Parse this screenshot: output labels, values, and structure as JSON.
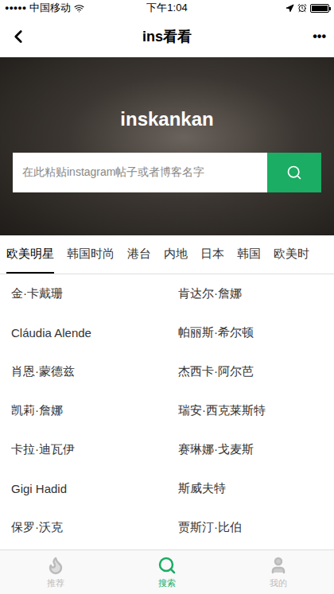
{
  "status_bar": {
    "signal": "●●●●●",
    "carrier": "中国移动",
    "time": "下午1:04"
  },
  "nav": {
    "title": "ins看看",
    "more": "•••"
  },
  "hero": {
    "title": "inskankan",
    "search_placeholder": "在此粘贴instagram帖子或者博客名字"
  },
  "tabs": [
    {
      "label": "欧美明星",
      "selected": true
    },
    {
      "label": "韩国时尚",
      "selected": false
    },
    {
      "label": "港台",
      "selected": false
    },
    {
      "label": "内地",
      "selected": false
    },
    {
      "label": "日本",
      "selected": false
    },
    {
      "label": "韩国",
      "selected": false
    },
    {
      "label": "欧美时",
      "selected": false
    }
  ],
  "names": [
    "金·卡戴珊",
    "肯达尔·詹娜",
    "Cláudia Alende",
    "帕丽斯·希尔顿",
    "肖恩·蒙德兹",
    "杰西卡·阿尔芭",
    "凯莉·詹娜",
    "瑞安·西克莱斯特",
    "卡拉·迪瓦伊",
    "赛琳娜·戈麦斯",
    "Gigi Hadid",
    "斯威夫特",
    "保罗·沃克",
    "贾斯汀·比伯"
  ],
  "bottom_tabs": [
    {
      "label": "推荐",
      "selected": false,
      "icon": "flame"
    },
    {
      "label": "搜索",
      "selected": true,
      "icon": "search"
    },
    {
      "label": "我的",
      "selected": false,
      "icon": "user"
    }
  ]
}
